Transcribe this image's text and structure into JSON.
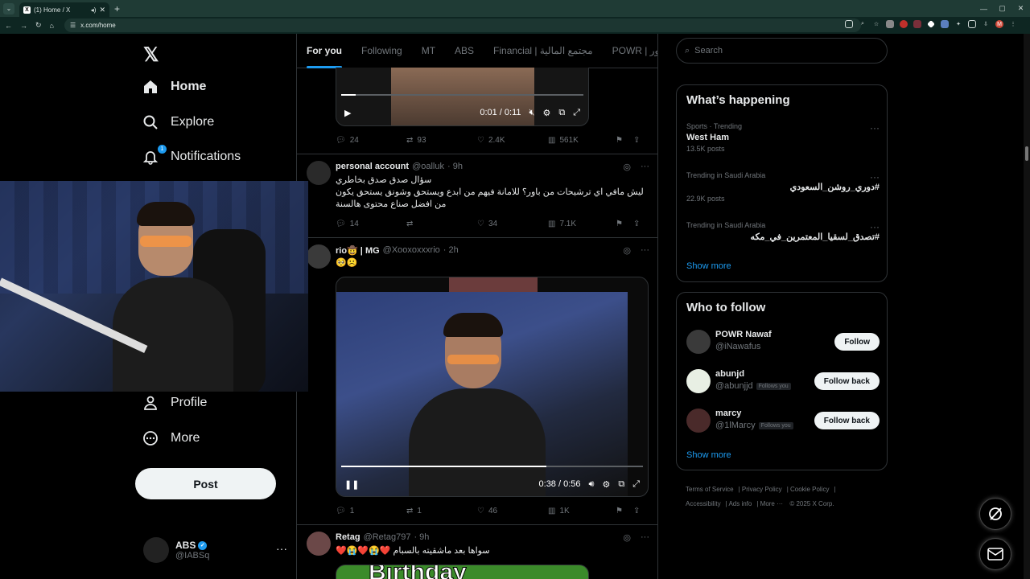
{
  "browser": {
    "tab_title": "(1) Home / X",
    "url": "x.com/home"
  },
  "nav": {
    "home": "Home",
    "explore": "Explore",
    "notifications": "Notifications",
    "notif_count": "1",
    "profile": "Profile",
    "more": "More",
    "post": "Post"
  },
  "account": {
    "name": "ABS",
    "handle": "@IABSq"
  },
  "feed_tabs": [
    "For you",
    "Following",
    "MT",
    "ABS",
    "Financial | مجتمع المالية",
    "POWR | ور"
  ],
  "tweet0": {
    "video_time": "0:01 / 0:11",
    "progress": 0.06,
    "replies": "24",
    "retweets": "93",
    "likes": "2.4K",
    "views": "561K"
  },
  "tweet1": {
    "name": "personal account",
    "handle": "@oalluk",
    "time": "· 9h",
    "line1": "سؤال صدق صدق بخاطري",
    "line2": "ليش مافي اي ترشيحات من باور؟ للامانة فيهم من ابدع ويستحق وشونق يستحق يكون",
    "line3": "من افضل صناع محتوى هالسنة",
    "replies": "14",
    "retweets": "",
    "likes": "34",
    "views": "7.1K"
  },
  "tweet2": {
    "name": "rio🤠 | MG",
    "handle": "@Xooxoxxxrio",
    "time": "· 2h",
    "text": "🥺☹️",
    "video_time": "0:38 / 0:56",
    "progress": 0.68,
    "replies": "1",
    "retweets": "1",
    "likes": "46",
    "views": "1K"
  },
  "tweet3": {
    "name": "Retag",
    "handle": "@Retag797",
    "time": "· 9h",
    "text": "سواها بعد ماشقيته بالسبام ❤️😭❤️😭❤️",
    "media_text": "Birthday"
  },
  "search": {
    "placeholder": "Search"
  },
  "happening": {
    "title": "What’s happening",
    "trends": [
      {
        "meta": "Sports · Trending",
        "name": "West Ham",
        "count": "13.5K posts"
      },
      {
        "meta": "Trending in Saudi Arabia",
        "name": "#دوري_روشن_السعودي",
        "count": "22.9K posts"
      },
      {
        "meta": "Trending in Saudi Arabia",
        "name": "#تصدق_لسقيا_المعتمرين_في_مكه",
        "count": ""
      }
    ],
    "show_more": "Show more"
  },
  "who_to_follow": {
    "title": "Who to follow",
    "users": [
      {
        "name": "POWR Nawaf",
        "handle": "@iNawafus",
        "follows_you": "",
        "button": "Follow"
      },
      {
        "name": "abunjd",
        "handle": "@abunjjd",
        "follows_you": "Follows you",
        "button": "Follow back"
      },
      {
        "name": "marcy",
        "handle": "@1lMarcy",
        "follows_you": "Follows you",
        "button": "Follow back"
      }
    ],
    "show_more": "Show more"
  },
  "footer": {
    "links": [
      "Terms of Service",
      "Privacy Policy",
      "Cookie Policy",
      "Accessibility",
      "Ads info",
      "More ···",
      "© 2025 X Corp."
    ]
  },
  "colors": {
    "accent": "#1d9bf0",
    "bg": "#000000",
    "border": "#2f3336",
    "muted": "#71767b"
  }
}
